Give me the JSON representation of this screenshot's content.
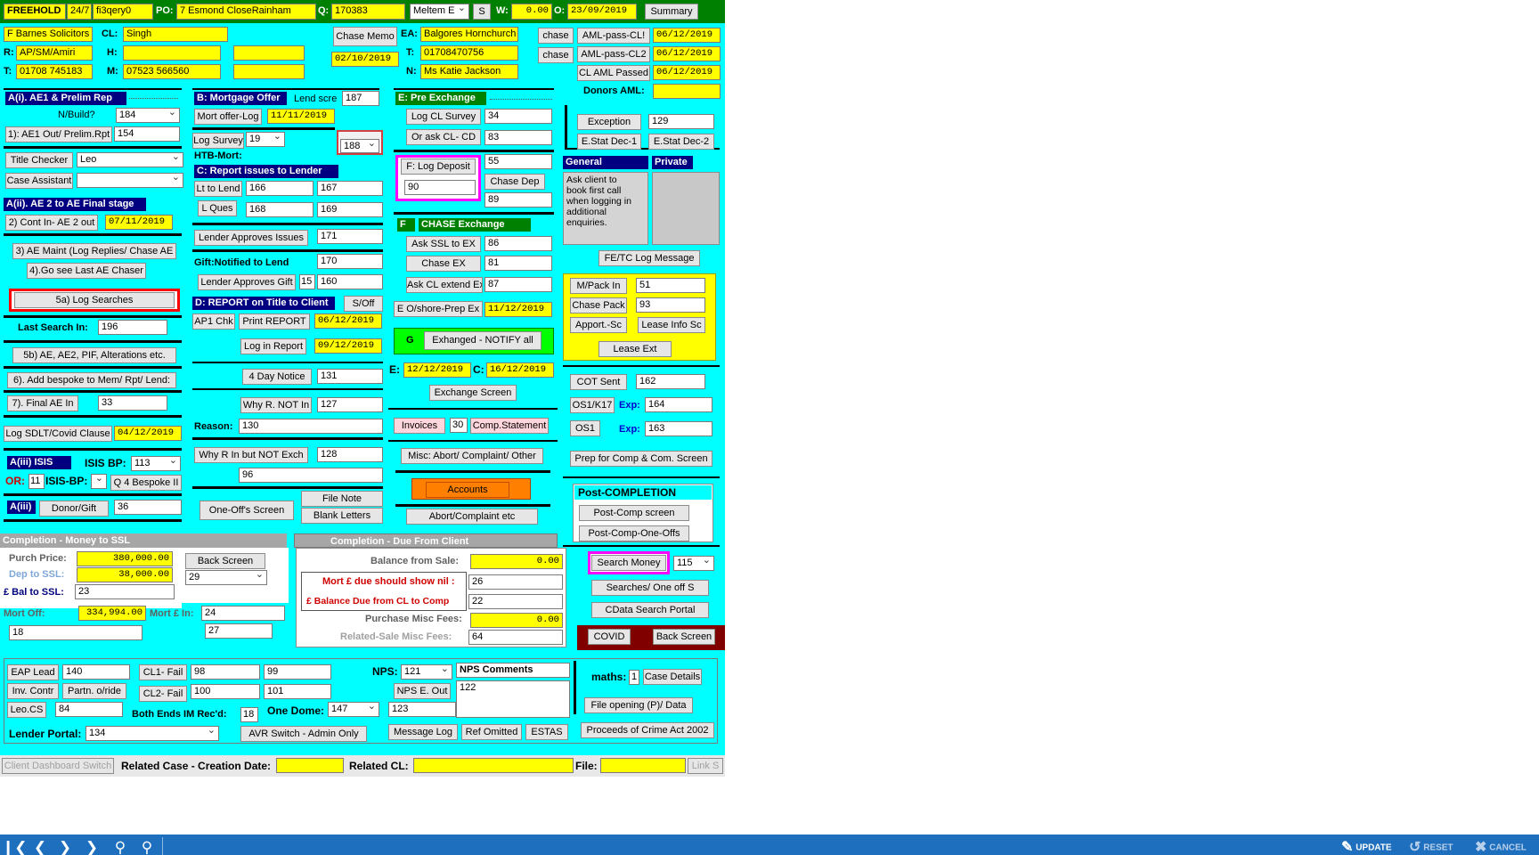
{
  "top": {
    "freehold": "FREEHOLD",
    "hours": "24/7",
    "ref": "fi3qery0",
    "po_label": "PO:",
    "po_value": "7 Esmond CloseRainham",
    "q_label": "Q:",
    "q_value": "170383",
    "meltem": "Meltem E",
    "s_btn": "S",
    "w_label": "W:",
    "w_value": "0.00",
    "o_label": "O:",
    "o_value": "23/09/2019",
    "summary_btn": "Summary"
  },
  "client": {
    "firm": "F Barnes Solicitors",
    "cl_label": "CL:",
    "cl_value": "Singh",
    "r_label": "R:",
    "r_value": "AP/SM/Amiri",
    "h_label": "H:",
    "t_label": "T:",
    "t_value": "01708 745183",
    "m_label": "M:",
    "m_value": "07523 566560",
    "chase_memo": "Chase Memo",
    "memo_date": "02/10/2019",
    "ea_label": "EA:",
    "ea_value": "Balgores Hornchurch",
    "ea_t_label": "T:",
    "ea_t_value": "01708470756",
    "n_label": "N:",
    "n_value": "Ms Katie Jackson"
  },
  "aml": {
    "chase1": "chase",
    "chase2": "chase",
    "aml1": "AML-pass-CL!",
    "aml1_date": "06/12/2019",
    "aml2": "AML-pass-CL2",
    "aml2_date": "06/12/2019",
    "aml3": "CL AML Passed",
    "aml3_date": "06/12/2019",
    "donors": "Donors AML:"
  },
  "ae": {
    "header": "A(i). AE1 & Prelim Rep",
    "nbuild": "N/Build?",
    "nbuild_value": "184",
    "ae1_out": "1): AE1 Out/ Prelim.Rpt",
    "ae1_value": "154",
    "title_checker": "Title Checker",
    "title_checker_value": "Leo",
    "case_assistant": "Case Assistant",
    "header2": "A(ii). AE 2 to AE Final stage",
    "cont_in": "2) Cont In- AE 2 out",
    "cont_date": "07/11/2019",
    "ae_maint": "3) AE Maint (Log Replies/ Chase AE",
    "go_see": "4).Go see Last AE Chaser",
    "log_searches": "5a) Log Searches",
    "last_search": "Last Search In:",
    "last_search_value": "196",
    "ae_pif": "5b) AE, AE2, PIF, Alterations etc.",
    "bespoke": "6). Add bespoke to Mem/ Rpt/ Lend:",
    "final_ae": "7). Final AE In",
    "final_ae_value": "33",
    "sdlt": "Log SDLT/Covid Clause",
    "sdlt_date": "04/12/2019",
    "isis": "A(iii) ISIS",
    "isis_bp": "ISIS BP:",
    "isis_bp_value": "113",
    "or": "OR:",
    "or_value": "11",
    "isis_bp2": "ISIS-BP:",
    "q4": "Q 4 Bespoke II",
    "aiiii": "A(iii)",
    "donor_gift": "Donor/Gift",
    "donor_value": "36"
  },
  "mortgage": {
    "header": "B: Mortgage Offer",
    "lend_scre": "Lend scre",
    "lend_scre_value": "187",
    "mort_offer_log": "Mort offer-Log",
    "mort_date": "11/11/2019",
    "log_survey": "Log Survey",
    "log_survey_value": "19",
    "htb_value": "188",
    "htb_mort": "HTB-Mort:",
    "report_hdr": "C: Report issues to Lender",
    "lt_lend": "Lt to Lend",
    "lt_v1": "166",
    "lt_v2": "167",
    "l_ques": "L Ques",
    "lq_v1": "168",
    "lq_v2": "169",
    "lender_approves": "Lender Approves Issues",
    "la_value": "171",
    "gift": "Gift:Notified to Lend",
    "gift_value": "170",
    "lag": "Lender Approves Gift",
    "lag_v1": "15",
    "lag_v2": "160"
  },
  "report": {
    "header": "D: REPORT on Title  to Client",
    "soff": "S/Off",
    "ap1": "AP1 Chk",
    "print": "Print REPORT",
    "print_date": "06/12/2019",
    "log_in": "Log in Report",
    "log_in_date": "09/12/2019",
    "notice": "4 Day Notice",
    "notice_value": "131",
    "why_not": "Why R. NOT In",
    "why_not_value": "127",
    "reason": "Reason:",
    "reason_value": "130",
    "why_exch": "Why R In but NOT Exch",
    "why_exch_value": "128",
    "v96": "96",
    "one_offs": "One-Off's Screen",
    "file_note": "File Note",
    "blank_letters": "Blank Letters"
  },
  "exchange": {
    "header": "E: Pre Exchange",
    "log_cl_survey": "Log CL Survey",
    "lcs_value": "34",
    "or_ask": "Or ask CL- CD",
    "or_ask_value": "83",
    "f_log": "F: Log Deposit",
    "f_value": "55",
    "deposit_value": "90",
    "chase_dep": "Chase Dep",
    "chase_dep_value": "89",
    "f_chase_label": "F",
    "chase_exchange": "CHASE Exchange",
    "ask_ssl": "Ask SSL to EX",
    "ask_ssl_value": "86",
    "chase_ex": "Chase EX",
    "chase_ex_value": "81",
    "ask_cl": "Ask CL extend Ex",
    "ask_cl_value": "87",
    "offshore": "E O/shore-Prep Ex",
    "offshore_date": "11/12/2019",
    "g": "G",
    "exchanged": "Exhanged - NOTIFY all",
    "e_label": "E:",
    "e_date": "12/12/2019",
    "c_label": "C:",
    "c_date": "16/12/2019",
    "exch_screen": "Exchange Screen",
    "invoices": "Invoices",
    "inv_value": "30",
    "comp_statement": "Comp.Statement",
    "misc": "Misc: Abort/ Complaint/ Other",
    "accounts": "Accounts",
    "abort": "Abort/Complaint etc"
  },
  "right": {
    "exception": "Exception",
    "exception_value": "129",
    "stat1": "E.Stat Dec-1",
    "stat2": "E.Stat Dec-2",
    "general": "General",
    "private": "Private",
    "general_text": "Ask client to book first call when logging in additional enquiries.",
    "fetc": "FE/TC Log Message",
    "mpack": "M/Pack In",
    "mpack_value": "51",
    "chase_pack": "Chase Pack",
    "chase_pack_value": "93",
    "apport": "Apport.-Sc",
    "lease_info": "Lease Info Sc",
    "lease_ext": "Lease Ext",
    "cot": "COT Sent",
    "cot_value": "162",
    "os1k17": "OS1/K17",
    "exp1": "Exp:",
    "exp1_value": "164",
    "os1": "OS1",
    "exp2": "Exp:",
    "exp2_value": "163",
    "prep": "Prep for Comp & Com. Screen",
    "post_hdr": "Post-COMPLETION",
    "post_comp": "Post-Comp screen",
    "post_one": "Post-Comp-One-Offs",
    "search_money": "Search Money",
    "sm_value": "115",
    "searches": "Searches/ One off S",
    "cdata": "CData Search Portal",
    "covid": "COVID",
    "back_screen": "Back Screen"
  },
  "completion": {
    "ssl_header": "Completion - Money to SSL",
    "client_header": "Completion - Due From Client",
    "purch_price": "Purch Price:",
    "purch_value": "380,000.00",
    "dep_ssl": "Dep to SSL:",
    "dep_value": "38,000.00",
    "bal_ssl": "£ Bal to SSL:",
    "bal_value": "23",
    "mort_off": "Mort Off:",
    "mort_off_value": "334,994.00",
    "mort_in": "Mort £ In:",
    "mort_in_value": "24",
    "v18": "18",
    "v27": "27",
    "back_screen": "Back Screen",
    "back_value": "29",
    "balance_sale": "Balance from Sale:",
    "balance_sale_value": "0.00",
    "mort_due": "Mort £ due should show nil :",
    "mort_due_value": "26",
    "bal_due": "£ Balance Due from CL to Comp",
    "bal_due_value": "22",
    "purch_misc": "Purchase Misc Fees:",
    "purch_misc_value": "0.00",
    "related_misc": "Related-Sale Misc Fees:",
    "related_misc_value": "64"
  },
  "bottom": {
    "eap": "EAP Lead",
    "eap_value": "140",
    "inv_contr": "Inv. Contr",
    "partn": "Partn. o/ride",
    "leo_cs": "Leo.CS",
    "leo_value": "84",
    "cl1": "CL1- Fail",
    "cl1_v1": "98",
    "cl1_v2": "99",
    "cl2": "CL2- Fail",
    "cl2_v1": "100",
    "cl2_v2": "101",
    "both_ends": "Both Ends IM Rec'd:",
    "both_value": "18",
    "one_dome": "One Dome:",
    "one_dome_value": "147",
    "v123": "123",
    "nps": "NPS:",
    "nps_value": "121",
    "nps_comments": "NPS Comments",
    "nps_e_out": "NPS E. Out",
    "nps_e_value": "122",
    "lender_portal": "Lender Portal:",
    "lender_portal_value": "134",
    "avr": "AVR Switch - Admin Only",
    "message_log": "Message Log",
    "ref_omitted": "Ref Omitted",
    "estas": "ESTAS",
    "maths": "maths:",
    "maths_value": "1",
    "case_details": "Case Details",
    "file_opening": "File opening (P)/ Data",
    "proceeds": "Proceeds of Crime Act 2002"
  },
  "status": {
    "dashboard": "Client Dashboard Switch",
    "related_case": "Related Case - Creation Date:",
    "related_cl": "Related CL:",
    "file": "File:",
    "link": "Link S"
  },
  "toolbar": {
    "update": "UPDATE",
    "reset": "RESET",
    "cancel": "CANCEL"
  }
}
